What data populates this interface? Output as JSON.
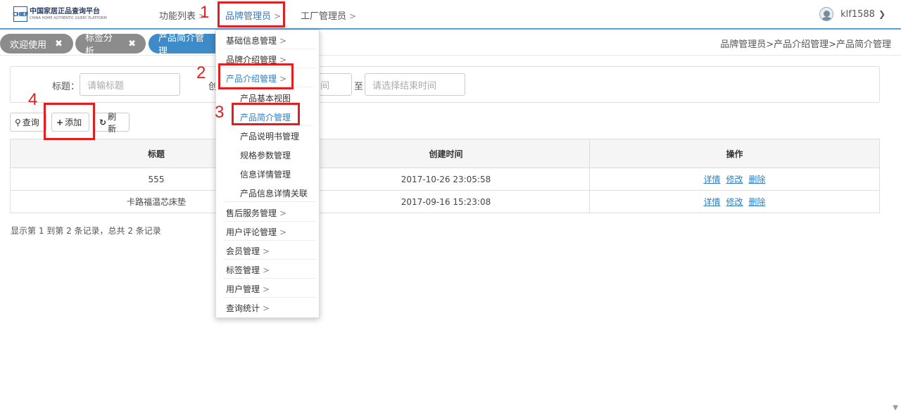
{
  "header": {
    "logo_mark": "CHIEF",
    "logo_title": "中国家居正品查询平台",
    "logo_sub": "CHINA HOME AUTHENTIC QUERY PLATFORM",
    "nav": [
      {
        "label": "功能列表",
        "chevron": ">"
      },
      {
        "label": "品牌管理员",
        "chevron": ">"
      },
      {
        "label": "工厂管理员",
        "chevron": ">"
      }
    ],
    "username": "klf1588"
  },
  "tabs": [
    {
      "label": "欢迎使用",
      "close": "✖"
    },
    {
      "label": "标签分析",
      "close": "✖"
    },
    {
      "label": "产品简介管理"
    }
  ],
  "breadcrumb": "品牌管理员>产品介绍管理>产品简介管理",
  "search": {
    "title_label": "标题：",
    "title_placeholder": "请输标题",
    "date_label_fragment": "创",
    "start_fragment": "间",
    "to_label": "至",
    "end_placeholder": "请选择结束时间"
  },
  "toolbar": {
    "query_label": "查询",
    "add_label": "添加",
    "refresh_label": "刷新"
  },
  "table": {
    "headers": [
      "标题",
      "创建时间",
      "操作"
    ],
    "rows": [
      {
        "title": "555",
        "time": "2017-10-26 23:05:58",
        "actions": [
          "详情",
          "修改",
          "删除"
        ]
      },
      {
        "title": "卡路福温芯床垫",
        "time": "2017-09-16 15:23:08",
        "actions": [
          "详情",
          "修改",
          "删除"
        ]
      }
    ]
  },
  "pagination_text": "显示第 1 到第 2 条记录，总共 2 条记录",
  "menu": {
    "items": [
      {
        "label": "基础信息管理",
        "chevron": ">"
      },
      {
        "label": "品牌介绍管理",
        "chevron": ">"
      },
      {
        "label": "产品介绍管理",
        "chevron": ">"
      },
      {
        "label": "产品基本视图"
      },
      {
        "label": "产品简介管理"
      },
      {
        "label": "产品说明书管理"
      },
      {
        "label": "规格参数管理"
      },
      {
        "label": "信息详情管理"
      },
      {
        "label": "产品信息详情关联"
      },
      {
        "label": "售后服务管理",
        "chevron": ">"
      },
      {
        "label": "用户评论管理",
        "chevron": ">"
      },
      {
        "label": "会员管理",
        "chevron": ">"
      },
      {
        "label": "标签管理",
        "chevron": ">"
      },
      {
        "label": "用户管理",
        "chevron": ">"
      },
      {
        "label": "查询统计",
        "chevron": ">"
      }
    ]
  },
  "annotations": [
    "1",
    "2",
    "3",
    "4"
  ],
  "colors": {
    "accent": "#3d8bc8",
    "annotation": "#e02020",
    "tab_inactive": "#8c8c8c"
  }
}
